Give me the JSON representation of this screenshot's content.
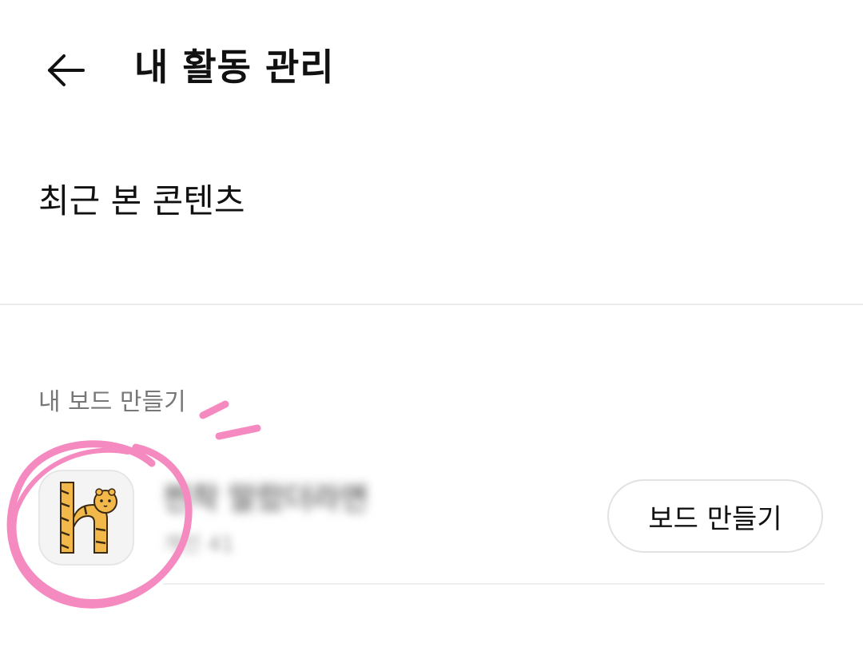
{
  "header": {
    "title": "내 활동 관리",
    "back_icon": "arrow-left-icon"
  },
  "recent": {
    "label": "최근 본 콘텐츠"
  },
  "boards": {
    "section_label": "내 보드 만들기",
    "item": {
      "name": "찐착 말랐더라면",
      "subtitle": "개인 41",
      "thumbnail_icon": "tiger-letter-h-icon"
    },
    "create_button_label": "보드 만들기"
  },
  "annotation": {
    "color": "#f58ac0"
  }
}
